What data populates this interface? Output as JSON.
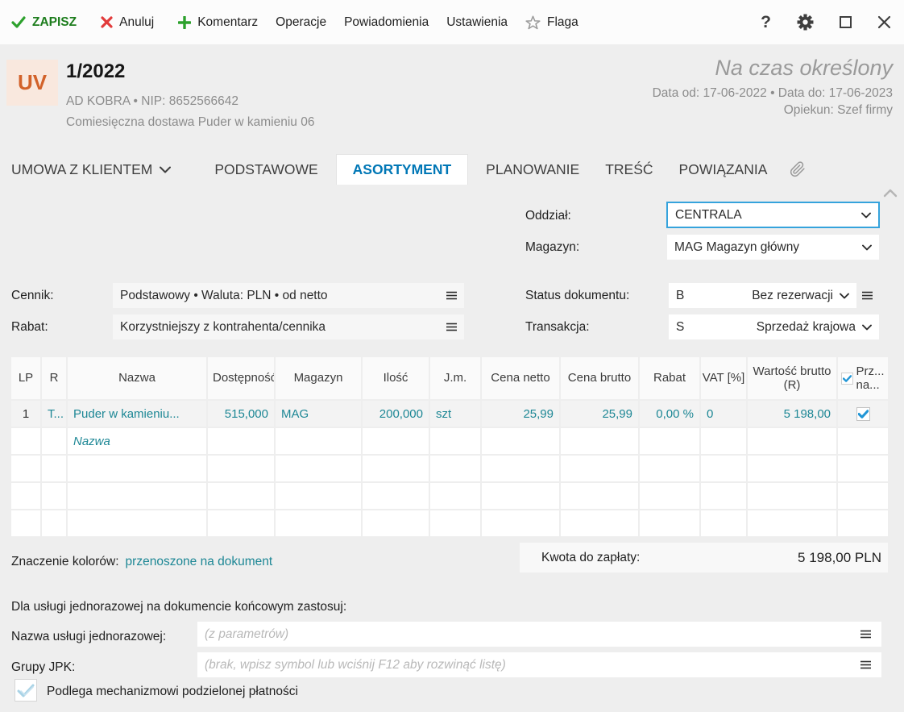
{
  "toolbar": {
    "save": "ZAPISZ",
    "cancel": "Anuluj",
    "comment": "Komentarz",
    "operations": "Operacje",
    "notifications": "Powiadomienia",
    "settings": "Ustawienia",
    "flag": "Flaga",
    "help": "?"
  },
  "header": {
    "badge": "UV",
    "number": "1/2022",
    "client_line": "AD KOBRA  •  NIP: 8652566642",
    "description": "Comiesięczna dostawa Puder w kamieniu 06",
    "term": "Na czas określony",
    "date_line": "Data od: 17-06-2022  •  Data do: 17-06-2023",
    "caretaker": "Opiekun: Szef firmy"
  },
  "tabs": {
    "menu_label": "UMOWA Z KLIENTEM",
    "tab_podstawowe": "PODSTAWOWE",
    "tab_asortyment": "ASORTYMENT",
    "tab_planowanie": "PLANOWANIE",
    "tab_tresc": "TREŚĆ",
    "tab_powiazania": "POWIĄZANIA"
  },
  "form": {
    "branch_label": "Oddział:",
    "branch_value": "CENTRALA",
    "warehouse_label": "Magazyn:",
    "warehouse_value": "MAG  Magazyn główny",
    "pricelist_label": "Cennik:",
    "pricelist_value": "Podstawowy • Waluta: PLN • od netto",
    "discount_label": "Rabat:",
    "discount_value": "Korzystniejszy z kontrahenta/cennika",
    "status_label": "Status dokumentu:",
    "status_code": "B",
    "status_value": "Bez rezerwacji",
    "transaction_label": "Transakcja:",
    "transaction_code": "S",
    "transaction_value": "Sprzedaż krajowa"
  },
  "table": {
    "headers": {
      "lp": "LP",
      "r": "R",
      "name": "Nazwa",
      "available": "Dostępność",
      "warehouse": "Magazyn",
      "quantity": "Ilość",
      "unit": "J.m.",
      "net_price": "Cena netto",
      "gross_price": "Cena brutto",
      "discount": "Rabat",
      "vat": "VAT [%]",
      "gross_value": "Wartość brutto (R)",
      "transfer": "Prz... na..."
    },
    "row1": {
      "lp": "1",
      "r": "T...",
      "name": "Puder w kamieniu...",
      "available": "515,000",
      "warehouse": "MAG",
      "quantity": "200,000",
      "unit": "szt",
      "net_price": "25,99",
      "gross_price": "25,99",
      "discount": "0,00 %",
      "vat": "0",
      "gross_value": "5 198,00"
    },
    "name_placeholder": "Nazwa"
  },
  "legend": {
    "label": "Znaczenie kolorów:",
    "value": "przenoszone na dokument"
  },
  "summary": {
    "label": "Kwota do zapłaty:",
    "value": "5 198,00 PLN"
  },
  "footer": {
    "section_title": "Dla usługi jednorazowej na dokumencie końcowym zastosuj:",
    "service_label": "Nazwa usługi jednorazowej:",
    "service_placeholder": "(z parametrów)",
    "jpk_label": "Grupy JPK:",
    "jpk_placeholder": "(brak, wpisz symbol lub wciśnij F12 aby rozwinąć listę)",
    "split_payment_label": "Podlega mechanizmowi podzielonej płatności"
  },
  "colors": {
    "accent_teal": "#1d8795",
    "active_tab_blue": "#0077b6",
    "focus_blue": "#35a3dc",
    "save_green": "#1d7d1d",
    "cancel_red": "#e23b3b",
    "badge_orange": "#d2622a",
    "badge_bg": "#f9e8de",
    "check_blue": "#2196d6"
  }
}
